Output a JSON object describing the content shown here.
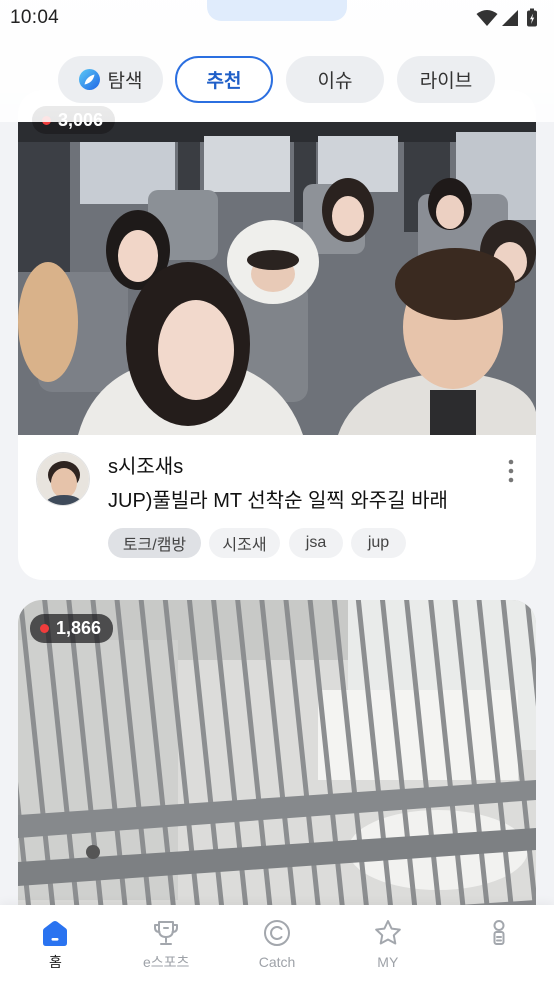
{
  "status_bar": {
    "time": "10:04",
    "icons": [
      "wifi-icon",
      "signal-icon",
      "battery-icon"
    ]
  },
  "top_tabs": [
    {
      "label": "탐색",
      "icon": "compass-icon",
      "selected": false
    },
    {
      "label": "추천",
      "selected": true
    },
    {
      "label": "이슈",
      "selected": false
    },
    {
      "label": "라이브",
      "selected": false
    }
  ],
  "feed": [
    {
      "live": true,
      "viewer_count": "3,006",
      "streamer_name": "s시조새s",
      "title": "JUP)풀빌라 MT 선착순 일찍 와주길 바래",
      "category": "토크/캠방",
      "tags": [
        "시조새",
        "jsa",
        "jup"
      ]
    },
    {
      "live": true,
      "viewer_count": "1,866"
    }
  ],
  "bottom_nav": [
    {
      "label": "홈",
      "icon": "home-icon",
      "active": true
    },
    {
      "label": "e스포츠",
      "icon": "trophy-icon",
      "active": false
    },
    {
      "label": "Catch",
      "icon": "catch-icon",
      "active": false
    },
    {
      "label": "MY",
      "icon": "star-icon",
      "active": false
    },
    {
      "icon": "person-icon",
      "active": false
    }
  ],
  "colors": {
    "accent": "#2b6fe0",
    "live_dot": "#f03c3c",
    "tab_bg": "#eceef1",
    "category_tag_bg": "#dfe1e5",
    "tag_bg": "#f1f2f4"
  }
}
